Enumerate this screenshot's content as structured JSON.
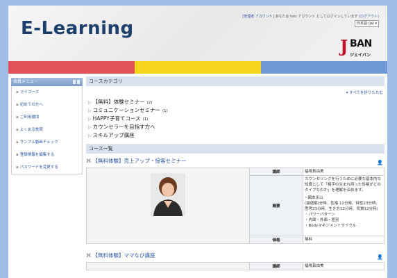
{
  "header": {
    "title": "E-Learning",
    "login_admin_link": "[管理者 アカウント]",
    "login_text": "あなたは test アカウント としてログインしています",
    "logout_link": "(ログアウト)",
    "language": "日本語 (ja)",
    "brand_initial": "J",
    "brand_name": "BAN",
    "brand_kana": "ジェイバン"
  },
  "colors": {
    "stripe_red": "#e05258",
    "stripe_yellow": "#f7d51c",
    "stripe_blue": "#6f99d4",
    "link": "#2a57a0"
  },
  "sidebar": {
    "heading": "会員メニュー",
    "items": [
      {
        "label": "マイコース"
      },
      {
        "label": "初めての方へ"
      },
      {
        "label": "ご利用環境"
      },
      {
        "label": "よくある質問"
      },
      {
        "label": "サンプル動画チェック"
      },
      {
        "label": "登録情報を編集する"
      },
      {
        "label": "パスワードを変更する"
      }
    ]
  },
  "categories": {
    "heading": "コースカテゴリ",
    "collapse_all": "すべてを折りたたむ",
    "items": [
      {
        "name": "【無料】体験セミナー",
        "count": "(2)"
      },
      {
        "name": "コミュニケーションセミナー",
        "count": "(1)"
      },
      {
        "name": "HAPPY子育てコース",
        "count": "(1)"
      },
      {
        "name": "カウンセラーを目指す方へ",
        "count": ""
      },
      {
        "name": "スキルアップ講座",
        "count": ""
      }
    ]
  },
  "courses": {
    "heading": "コース一覧",
    "list": [
      {
        "title": "【無料体験】売上アップ・接客セミナー",
        "instructor_label": "講師",
        "instructor": "福場真由美",
        "overview_label": "概要",
        "overview": "カウンセリングを行うために必要な基本的な知識として「相手の生まれ持った性格がどのタイプなのか」を理解を深めます。",
        "overview_lines": [
          "~図本永山",
          "(接遇編)分時、性格 12分時、特性23分時、思考23分時、生き方12分時、気質12分時)",
          "・パワーパターン",
          "・内面・外面・差別",
          "・Bodyマネジメントサイクル"
        ],
        "price_label": "価格",
        "price": "無料"
      },
      {
        "title": "【無料体験】ママなび講座",
        "instructor_label": "講師",
        "instructor": "福場真由美"
      }
    ]
  }
}
